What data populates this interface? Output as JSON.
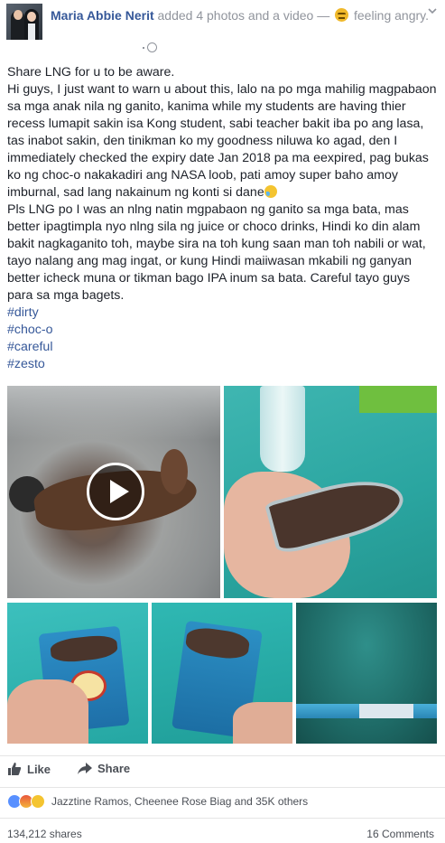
{
  "header": {
    "author_name": "Maria Abbie Nerit",
    "action_text": "added 4 photos and a video —",
    "feeling_text": "feeling angry.",
    "feeling_icon": "angry-face-icon"
  },
  "post": {
    "lines": [
      "Share LNG for u to be aware.",
      "Hi guys, I just want to warn u about this, lalo na po mga mahilig magpabaon sa mga anak nila ng ganito, kanima while my students are having thier recess lumapit sakin isa Kong student, sabi teacher bakit iba po ang lasa, tas inabot sakin, den tinikman ko my goodness niluwa ko agad, den I immediately checked the expiry date Jan 2018 pa ma eexpired, pag bukas ko ng choc-o nakakadiri ang NASA loob, pati amoy super baho amoy imburnal, sad lang nakainum ng konti si dane",
      "Pls LNG po I was an nlng natin mgpabaon ng ganito sa mga bata, mas better ipagtimpla nyo nlng sila ng juice or choco drinks, Hindi ko din alam bakit nagkaganito toh, maybe sira na toh kung saan man toh nabili or wat, tayo nalang ang mag ingat, or kung Hindi maiiwasan mkabili ng ganyan better icheck muna or tikman bago IPA inum sa bata. Careful tayo guys para sa mga bagets."
    ],
    "hashtags": [
      "#dirty",
      "#choc-o",
      "#careful",
      "#zesto"
    ]
  },
  "media": {
    "video_play_icon": "play-icon"
  },
  "actions": {
    "like_label": "Like",
    "share_label": "Share"
  },
  "reactions": {
    "summary": "Jazztine Ramos, Cheenee Rose Biag and 35K others"
  },
  "footer": {
    "shares": "134,212 shares",
    "comments": "16 Comments"
  },
  "colors": {
    "link": "#365899",
    "meta_gray": "#90949c",
    "text": "#1d2129"
  }
}
